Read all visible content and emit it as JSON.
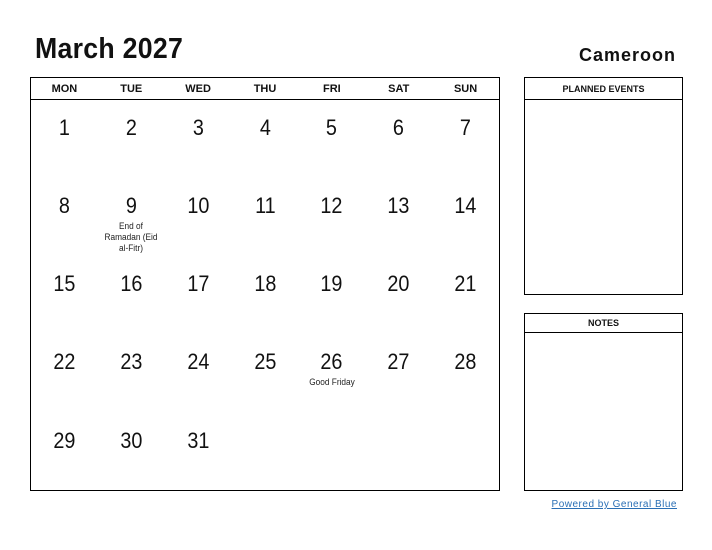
{
  "header": {
    "title": "March 2027",
    "country": "Cameroon"
  },
  "calendar": {
    "weekdays": [
      "MON",
      "TUE",
      "WED",
      "THU",
      "FRI",
      "SAT",
      "SUN"
    ],
    "weeks": [
      [
        {
          "day": "1"
        },
        {
          "day": "2"
        },
        {
          "day": "3"
        },
        {
          "day": "4"
        },
        {
          "day": "5"
        },
        {
          "day": "6"
        },
        {
          "day": "7"
        }
      ],
      [
        {
          "day": "8"
        },
        {
          "day": "9",
          "event": "End of Ramadan (Eid al-Fitr)"
        },
        {
          "day": "10"
        },
        {
          "day": "11"
        },
        {
          "day": "12"
        },
        {
          "day": "13"
        },
        {
          "day": "14"
        }
      ],
      [
        {
          "day": "15"
        },
        {
          "day": "16"
        },
        {
          "day": "17"
        },
        {
          "day": "18"
        },
        {
          "day": "19"
        },
        {
          "day": "20"
        },
        {
          "day": "21"
        }
      ],
      [
        {
          "day": "22"
        },
        {
          "day": "23"
        },
        {
          "day": "24"
        },
        {
          "day": "25"
        },
        {
          "day": "26",
          "event": "Good Friday"
        },
        {
          "day": "27"
        },
        {
          "day": "28"
        }
      ],
      [
        {
          "day": "29"
        },
        {
          "day": "30"
        },
        {
          "day": "31"
        },
        {
          "day": ""
        },
        {
          "day": ""
        },
        {
          "day": ""
        },
        {
          "day": ""
        }
      ]
    ]
  },
  "panels": {
    "planned_events": "PLANNED EVENTS",
    "notes": "NOTES"
  },
  "footer": {
    "powered_by": "Powered by General Blue",
    "link_color": "#2a6fb5"
  }
}
